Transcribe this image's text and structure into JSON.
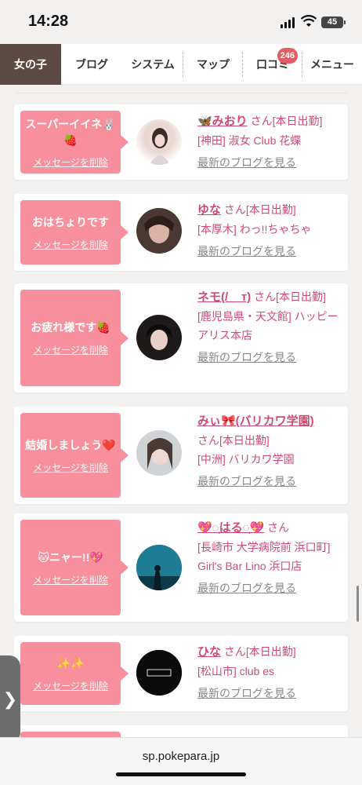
{
  "status": {
    "time": "14:28",
    "battery": "45"
  },
  "nav": {
    "items": [
      "女の子",
      "ブログ",
      "システム",
      "マップ",
      "口コミ",
      "メニュー"
    ],
    "badge": "246"
  },
  "cards": [
    {
      "message": "スーパーイイネ🐰🍓",
      "delete_label": "メッセージを削除",
      "name": "🦋みおり",
      "suffix": "さん[本日出勤]",
      "shop": "[神田] 淑女 Club 花蝶",
      "blog_link": "最新のブログを見る"
    },
    {
      "message": "おはちょりです",
      "delete_label": "メッセージを削除",
      "name": "ゆな",
      "suffix": "さん[本日出勤]",
      "shop": "[本厚木] わっ!!ちゃちゃ",
      "blog_link": "最新のブログを見る"
    },
    {
      "message": "お疲れ様です🍓",
      "delete_label": "メッセージを削除",
      "name": "ネモ(/ _ т)",
      "suffix": "さん[本日出勤]",
      "shop": "[鹿児島県・天文館] ハッピーアリス本店",
      "blog_link": "最新のブログを見る"
    },
    {
      "message": "結婚しましょう❤️",
      "delete_label": "メッセージを削除",
      "name": "みぃ🎀(バリカワ学園)",
      "suffix": "さん[本日出勤]",
      "shop": "[中洲] バリカワ学園",
      "blog_link": "最新のブログを見る"
    },
    {
      "message": "🐱ニャー!!💖",
      "delete_label": "メッセージを削除",
      "name": "💖◌͙はる◌͙💖",
      "suffix": "さん",
      "shop": "[長崎市 大学病院前 浜口町] Girl's Bar Lino 浜口店",
      "blog_link": "最新のブログを見る"
    },
    {
      "message": "✨✨",
      "delete_label": "メッセージを削除",
      "name": "ひな",
      "suffix": "さん[本日出勤]",
      "shop": "[松山市] club es",
      "blog_link": "最新のブログを見る"
    }
  ],
  "url": "sp.pokepara.jp",
  "side_tab_label": "❯"
}
